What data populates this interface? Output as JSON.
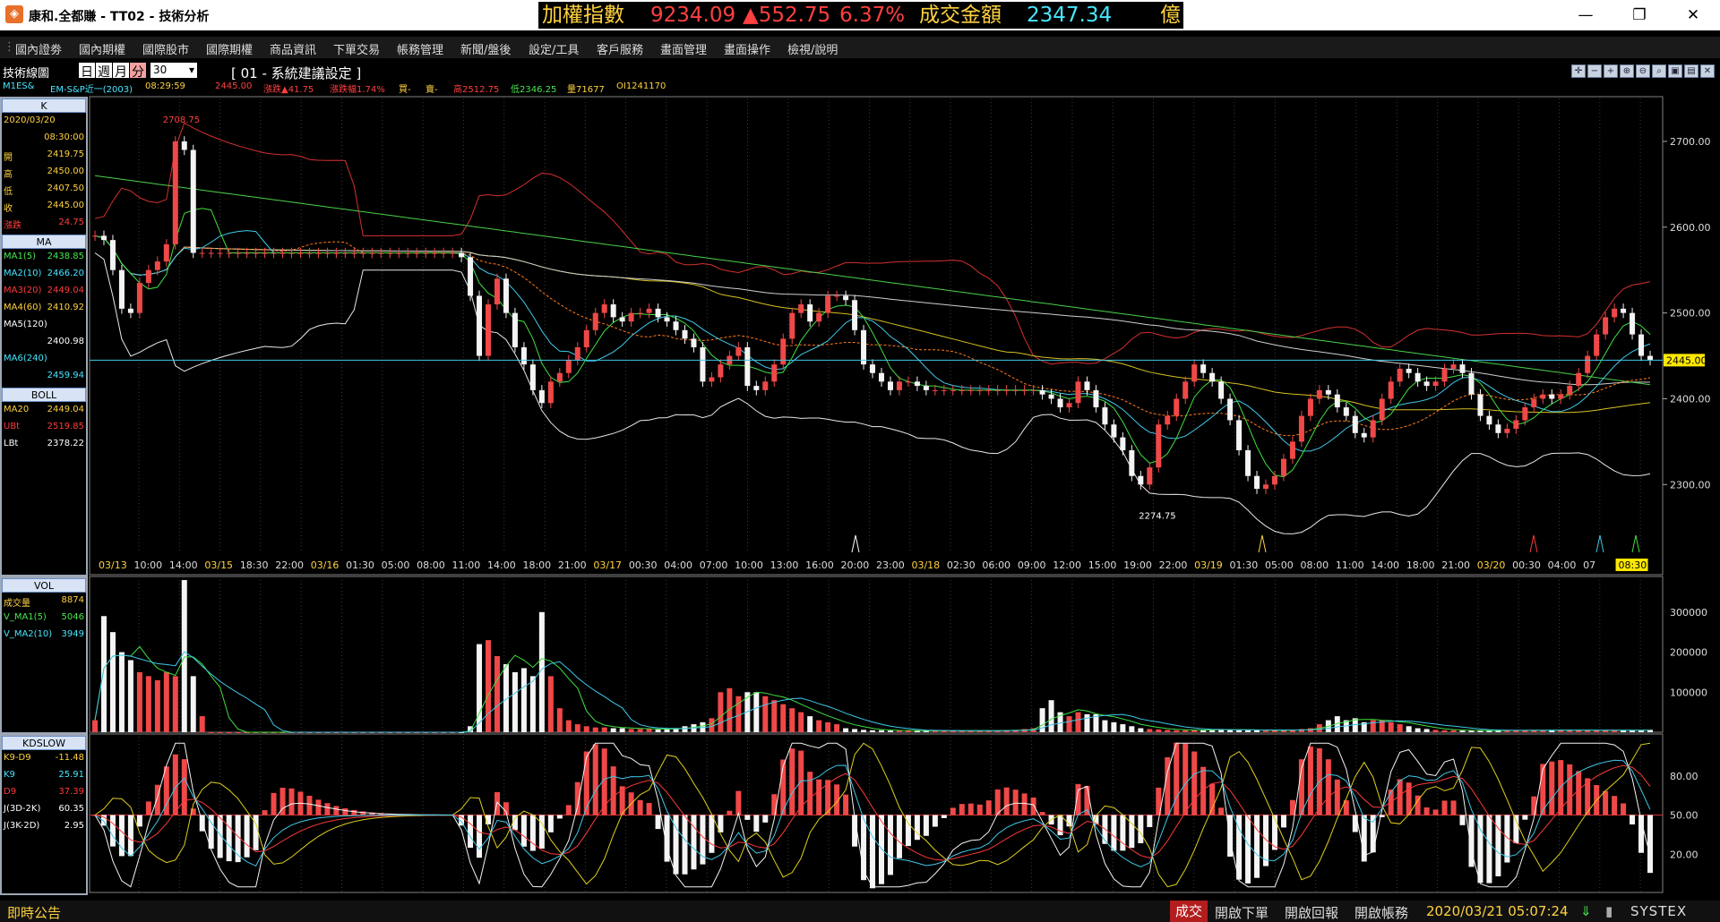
{
  "window": {
    "title": "康和.全都賺 - TT02 - 技術分析",
    "ticker_label": "加權指數",
    "ticker_value": "9234.09",
    "ticker_change": "▲552.75",
    "ticker_pct": "6.37%",
    "turnover_label": "成交金額",
    "turnover_value": "2347.34",
    "turnover_unit": "億",
    "colors": {
      "ticker_label": "#ffd23f",
      "ticker_value": "#ff4040",
      "turnover_value": "#47e6ff"
    }
  },
  "menu": [
    "國內證劵",
    "國內期權",
    "國際股市",
    "國際期權",
    "商品資訊",
    "下單交易",
    "帳務管理",
    "新聞/盤後",
    "設定/工具",
    "客戶服務",
    "畫面管理",
    "畫面操作",
    "檢視/說明"
  ],
  "toolbar": {
    "chart_title": "技術線圖",
    "periods": [
      "日",
      "週",
      "月",
      "分"
    ],
    "active_period": "分",
    "interval": "30",
    "setting_label": "[ 01 - 系統建議設定 ]"
  },
  "info": {
    "symbol": "M1ES&",
    "name": "EM-S&P近一(2003)",
    "time": "08:29:59",
    "price": "2445.00",
    "change": "漲跌▲41.75",
    "change_pct": "漲跌幅1.74%",
    "bid": "買-",
    "ask": "賣-",
    "high": "高2512.75",
    "low": "低2346.25",
    "volume": "量71677",
    "oi": "OI1241170"
  },
  "left_panel": {
    "k": {
      "header": "K",
      "date": "2020/03/20",
      "time": "08:30:00",
      "rows": [
        {
          "label": "開",
          "value": "2419.75"
        },
        {
          "label": "高",
          "value": "2450.00"
        },
        {
          "label": "低",
          "value": "2407.50"
        },
        {
          "label": "收",
          "value": "2445.00"
        },
        {
          "label": "漲跌",
          "value": "24.75"
        }
      ]
    },
    "ma": {
      "header": "MA",
      "rows": [
        {
          "label": "MA1(5)",
          "value": "2438.85"
        },
        {
          "label": "MA2(10)",
          "value": "2466.20"
        },
        {
          "label": "MA3(20)",
          "value": "2449.04"
        },
        {
          "label": "MA4(60)",
          "value": "2410.92"
        },
        {
          "label": "MA5(120)",
          "value": ""
        },
        {
          "label": "",
          "value": "2400.98"
        },
        {
          "label": "MA6(240)",
          "value": ""
        },
        {
          "label": "",
          "value": "2459.94"
        }
      ]
    },
    "boll": {
      "header": "BOLL",
      "rows": [
        {
          "label": "MA20",
          "value": "2449.04"
        },
        {
          "label": "UBt",
          "value": "2519.85"
        },
        {
          "label": "LBt",
          "value": "2378.22"
        }
      ]
    },
    "vol": {
      "header": "VOL",
      "rows": [
        {
          "label": "成交量",
          "value": "8874"
        },
        {
          "label": "V_MA1(5)",
          "value": "5046"
        },
        {
          "label": "V_MA2(10)",
          "value": "3949"
        }
      ]
    },
    "kd": {
      "header": "KDSLOW",
      "rows": [
        {
          "label": "K9-D9",
          "value": "-11.48"
        },
        {
          "label": "K9",
          "value": "25.91"
        },
        {
          "label": "D9",
          "value": "37.39"
        },
        {
          "label": "J(3D-2K)",
          "value": "60.35"
        },
        {
          "label": "J(3K-2D)",
          "value": "2.95"
        }
      ]
    }
  },
  "chart_data": [
    {
      "type": "candlestick",
      "y_ticks": [
        2300,
        2400,
        2500,
        2600,
        2700
      ],
      "y_tick_labels": [
        "2300.00",
        "2400.00",
        "2500.00",
        "2600.00",
        "2700.00"
      ],
      "ylim": [
        2220,
        2750
      ],
      "last_price_label": "2445.00",
      "high_annotation": "2708.75",
      "low_annotation": "2274.75",
      "x_tick_labels": [
        "03/13",
        "10:00",
        "14:00",
        "03/15",
        "18:30",
        "22:00",
        "03/16",
        "01:30",
        "05:00",
        "08:00",
        "11:00",
        "14:00",
        "18:00",
        "21:00",
        "03/17",
        "00:30",
        "04:00",
        "07:00",
        "10:00",
        "13:00",
        "16:00",
        "20:00",
        "23:00",
        "03/18",
        "02:30",
        "06:00",
        "09:00",
        "12:00",
        "15:00",
        "19:00",
        "22:00",
        "03/19",
        "01:30",
        "05:00",
        "08:00",
        "11:00",
        "14:00",
        "18:00",
        "21:00",
        "03/20",
        "00:30",
        "04:00",
        "07",
        "08:30"
      ],
      "closes": [
        2590,
        2585,
        2550,
        2505,
        2500,
        2535,
        2550,
        2560,
        2580,
        2700,
        2690,
        2570,
        2570,
        2570,
        2570,
        2570,
        2570,
        2570,
        2570,
        2570,
        2570,
        2570,
        2570,
        2570,
        2570,
        2570,
        2570,
        2570,
        2570,
        2570,
        2570,
        2570,
        2570,
        2570,
        2570,
        2570,
        2570,
        2570,
        2570,
        2570,
        2570,
        2565,
        2520,
        2450,
        2510,
        2540,
        2500,
        2460,
        2440,
        2410,
        2395,
        2420,
        2430,
        2445,
        2460,
        2480,
        2500,
        2510,
        2495,
        2490,
        2500,
        2500,
        2505,
        2495,
        2490,
        2480,
        2470,
        2460,
        2420,
        2425,
        2440,
        2450,
        2460,
        2415,
        2410,
        2420,
        2440,
        2470,
        2500,
        2510,
        2490,
        2500,
        2520,
        2520,
        2515,
        2480,
        2440,
        2430,
        2420,
        2410,
        2420,
        2420,
        2415,
        2410,
        2410,
        2410,
        2410,
        2410,
        2410,
        2410,
        2410,
        2410,
        2410,
        2410,
        2410,
        2410,
        2405,
        2400,
        2390,
        2395,
        2420,
        2410,
        2390,
        2370,
        2355,
        2340,
        2310,
        2300,
        2320,
        2370,
        2380,
        2400,
        2420,
        2440,
        2430,
        2420,
        2400,
        2375,
        2340,
        2310,
        2295,
        2300,
        2310,
        2330,
        2350,
        2380,
        2400,
        2410,
        2405,
        2390,
        2380,
        2360,
        2355,
        2375,
        2400,
        2420,
        2435,
        2430,
        2420,
        2415,
        2420,
        2435,
        2440,
        2430,
        2405,
        2380,
        2370,
        2360,
        2365,
        2375,
        2390,
        2400,
        2405,
        2400,
        2405,
        2415,
        2430,
        2450,
        2475,
        2495,
        2505,
        2500,
        2475,
        2450,
        2445
      ]
    },
    {
      "type": "bar",
      "name": "VOL",
      "y_ticks": [
        100000,
        200000,
        300000
      ],
      "y_tick_labels": [
        "100000",
        "200000",
        "300000"
      ],
      "ylim": [
        0,
        380000
      ],
      "values": [
        30000,
        290000,
        250000,
        200000,
        180000,
        150000,
        140000,
        130000,
        150000,
        140000,
        380000,
        140000,
        40000,
        0,
        0,
        0,
        0,
        0,
        0,
        0,
        0,
        0,
        0,
        0,
        0,
        0,
        0,
        0,
        0,
        0,
        0,
        0,
        0,
        0,
        0,
        0,
        0,
        0,
        0,
        0,
        0,
        0,
        15000,
        220000,
        230000,
        190000,
        170000,
        150000,
        160000,
        140000,
        300000,
        140000,
        60000,
        30000,
        20000,
        15000,
        12000,
        12000,
        10000,
        10000,
        8000,
        8000,
        8000,
        7000,
        8000,
        10000,
        15000,
        20000,
        25000,
        35000,
        100000,
        110000,
        90000,
        100000,
        100000,
        90000,
        80000,
        70000,
        60000,
        50000,
        40000,
        30000,
        25000,
        20000,
        10000,
        8000,
        6000,
        5000,
        5000,
        4000,
        4000,
        4000,
        4000,
        4000,
        4000,
        4000,
        4000,
        4000,
        4000,
        4000,
        4000,
        4000,
        5000,
        6000,
        8000,
        10000,
        60000,
        80000,
        50000,
        40000,
        50000,
        45000,
        45000,
        30000,
        25000,
        20000,
        15000,
        10000,
        8000,
        7000,
        6000,
        5000,
        5000,
        5000,
        6000,
        7000,
        8000,
        6000,
        5000,
        5000,
        5000,
        4000,
        5000,
        5000,
        6000,
        8000,
        10000,
        20000,
        30000,
        40000,
        30000,
        35000,
        25000,
        30000,
        30000,
        25000,
        20000,
        15000,
        10000,
        8000,
        6000,
        5000,
        5000,
        4000,
        4000,
        4000,
        4000,
        5000,
        5000,
        5000,
        5000,
        5000,
        5000,
        6000,
        6000,
        5000,
        5000,
        5000,
        5000,
        5000,
        5000,
        5000,
        5000,
        5000,
        6000
      ]
    },
    {
      "type": "bar",
      "name": "KDSLOW",
      "y_ticks": [
        20,
        50,
        80
      ],
      "y_tick_labels": [
        "20.00",
        "50.00",
        "80.00"
      ],
      "ylim": [
        -10,
        110
      ]
    }
  ]
}
